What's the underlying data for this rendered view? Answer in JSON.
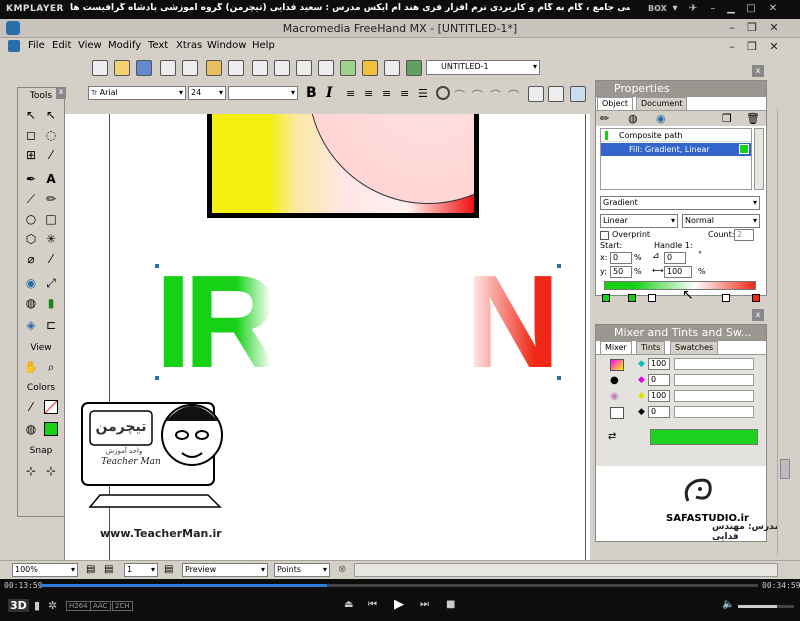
{
  "player": {
    "logo": "KMPLAYER",
    "title": "مجموعه آموزشی جامع ، گام به گام و کاربردی نرم افزار فری هند ام ایکس  مدرس : سعید فدایی (تیچرمن) گروه آموزشی بادشاه گرافیست ها",
    "box_label": "BOX",
    "time_current": "00:13:59",
    "time_total": "00:34:59",
    "progress": 0.4,
    "badges": [
      "H264",
      "AAC",
      "2CH"
    ],
    "volume": 0.7
  },
  "app": {
    "title": "Macromedia FreeHand MX - [UNTITLED-1*]",
    "menu": [
      "File",
      "Edit",
      "View",
      "Modify",
      "Text",
      "Xtras",
      "Window",
      "Help"
    ],
    "document_select": "UNTITLED-1",
    "font_name": "Arial",
    "font_size": "24",
    "bold_label": "B",
    "italic_label": "I",
    "text_icon": "Tr"
  },
  "tools_panel": {
    "title": "Tools",
    "view_title": "View",
    "colors_title": "Colors",
    "snap_title": "Snap",
    "close": "x"
  },
  "canvas": {
    "green_text": "IR",
    "red_text": "N"
  },
  "watermark": {
    "brand_fa": "تیچرمن",
    "brand_en": "Teacher Man",
    "sub_fa": "واحد آموزش",
    "url": "www.TeacherMan.ir"
  },
  "properties": {
    "title": "Properties",
    "tabs": [
      "Object",
      "Document"
    ],
    "list": [
      "Composite path",
      "Fill: Gradient, Linear"
    ],
    "fill_type": "Gradient",
    "gradient_type": "Linear",
    "blend": "Normal",
    "overprint_label": "Overprint",
    "count_label": "Count:",
    "count_value": "2",
    "start_label": "Start:",
    "handle_label": "Handle 1:",
    "x_label": "x:",
    "x_value": "0",
    "y_label": "y:",
    "y_value": "50",
    "angle_value": "0",
    "length_value": "100",
    "pct": "%",
    "deg": "°",
    "close": "x"
  },
  "mixer": {
    "title": "Mixer and Tints and Sw...",
    "tabs": [
      "Mixer",
      "Tints",
      "Swatches"
    ],
    "values": [
      "100",
      "0",
      "100",
      "0"
    ],
    "swatch_color": "#1fd21f",
    "close": "x"
  },
  "logo2": {
    "name": "SAFASTUDIO.ir",
    "caption": "مدرس: مهندس فدایی"
  },
  "statusbar": {
    "zoom": "100%",
    "page": "1",
    "mode": "Preview",
    "units": "Points"
  },
  "colors": {
    "green": "#17d117",
    "red": "#f02818",
    "yellow": "#f5f010"
  }
}
